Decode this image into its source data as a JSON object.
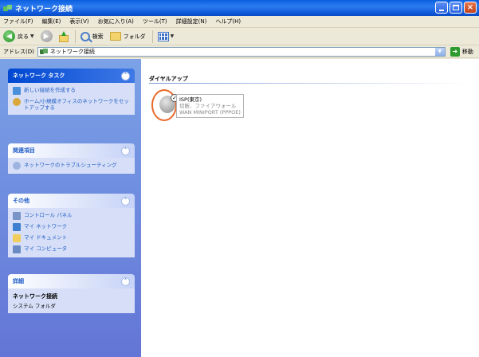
{
  "window": {
    "title": "ネットワーク接続"
  },
  "menubar": {
    "items": [
      "ファイル(F)",
      "編集(E)",
      "表示(V)",
      "お気に入り(A)",
      "ツール(T)",
      "詳細設定(N)",
      "ヘルプ(H)"
    ]
  },
  "toolbar": {
    "back_label": "戻る",
    "search_label": "検索",
    "folders_label": "フォルダ"
  },
  "address": {
    "label": "アドレス(D)",
    "value": "ネットワーク接続",
    "go_label": "移動"
  },
  "left_pane": {
    "network_tasks": {
      "title": "ネットワーク タスク",
      "items": [
        "新しい接続を作成する",
        "ホーム/小規模オフィスのネットワークをセットアップする"
      ]
    },
    "see_also": {
      "title": "関連項目",
      "items": [
        "ネットワークのトラブルシューティング"
      ]
    },
    "other_places": {
      "title": "その他",
      "items": [
        "コントロール パネル",
        "マイ ネットワーク",
        "マイ ドキュメント",
        "マイ コンピュータ"
      ]
    },
    "details": {
      "title": "詳細",
      "name": "ネットワーク接続",
      "type": "システム フォルダ"
    }
  },
  "main": {
    "group_header": "ダイヤルアップ",
    "item": {
      "name": "ISP(東京)",
      "status": "切断、ファイアウォール",
      "device": "WAN MINIPORT (PPPOE)"
    }
  },
  "colors": {
    "titlebar": "#0a5fe0",
    "task_link": "#215dc6",
    "left_pane_bg": "#7ba2e7",
    "highlight_ring": "#e86a2a"
  }
}
